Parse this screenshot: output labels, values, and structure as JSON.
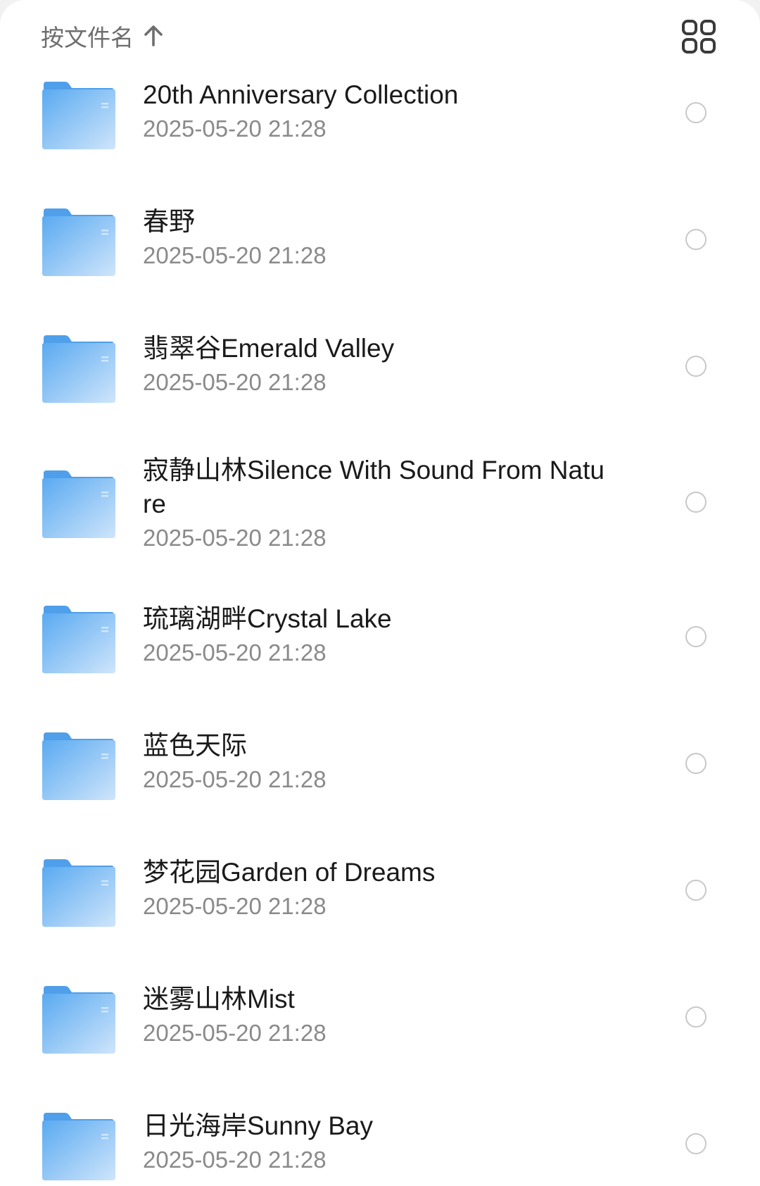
{
  "header": {
    "sort_label": "按文件名",
    "sort_icon": "arrow-up-icon",
    "view_toggle_icon": "grid-view-icon"
  },
  "colors": {
    "folder_light": "#cfe5fb",
    "folder_dark": "#5aaaf1",
    "text_primary": "#1a1a1a",
    "text_secondary": "#8a8a8a"
  },
  "folders": [
    {
      "name": "20th Anniversary Collection",
      "date": "2025-05-20 21:28"
    },
    {
      "name": "春野",
      "date": "2025-05-20 21:28"
    },
    {
      "name": "翡翠谷Emerald Valley",
      "date": "2025-05-20 21:28"
    },
    {
      "name": "寂静山林Silence With Sound From Nature",
      "date": "2025-05-20 21:28"
    },
    {
      "name": "琉璃湖畔Crystal Lake",
      "date": "2025-05-20 21:28"
    },
    {
      "name": "蓝色天际",
      "date": "2025-05-20 21:28"
    },
    {
      "name": "梦花园Garden of Dreams",
      "date": "2025-05-20 21:28"
    },
    {
      "name": "迷雾山林Mist",
      "date": "2025-05-20 21:28"
    },
    {
      "name": "日光海岸Sunny Bay",
      "date": "2025-05-20 21:28"
    }
  ]
}
